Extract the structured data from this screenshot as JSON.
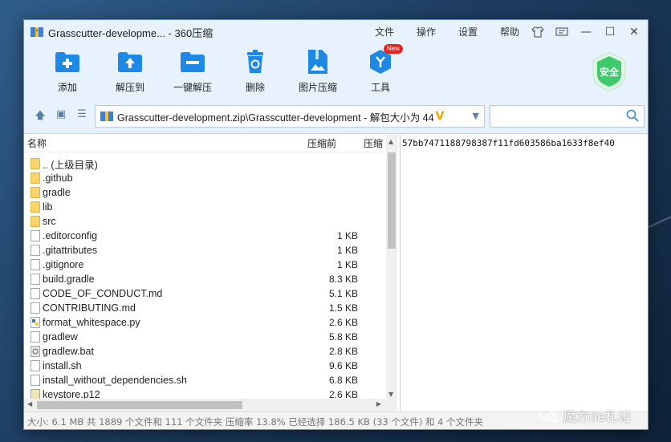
{
  "window": {
    "title": "Grasscutter-developme... - 360压缩",
    "menus": [
      "文件",
      "操作",
      "设置",
      "帮助"
    ]
  },
  "toolbar": {
    "items": [
      {
        "label": "添加",
        "icon": "add-icon"
      },
      {
        "label": "解压到",
        "icon": "extract-to-icon"
      },
      {
        "label": "一键解压",
        "icon": "one-click-extract-icon"
      },
      {
        "label": "删除",
        "icon": "delete-icon"
      },
      {
        "label": "图片压缩",
        "icon": "image-compress-icon"
      },
      {
        "label": "工具",
        "icon": "tools-icon",
        "badge": "New"
      }
    ],
    "safe_badge": "安全"
  },
  "address": {
    "path": "Grasscutter-development.zip\\Grasscutter-development - 解包大小为 44",
    "v_mark": "V",
    "search_placeholder": ""
  },
  "filelist": {
    "columns": {
      "name": "名称",
      "size": "压缩前",
      "packed": "压缩"
    },
    "rows": [
      {
        "name": ".. (上级目录)",
        "size": "",
        "type": "folder"
      },
      {
        "name": ".github",
        "size": "",
        "type": "folder"
      },
      {
        "name": "gradle",
        "size": "",
        "type": "folder"
      },
      {
        "name": "lib",
        "size": "",
        "type": "folder"
      },
      {
        "name": "src",
        "size": "",
        "type": "folder"
      },
      {
        "name": ".editorconfig",
        "size": "1 KB",
        "type": "file"
      },
      {
        "name": ".gitattributes",
        "size": "1 KB",
        "type": "file"
      },
      {
        "name": ".gitignore",
        "size": "1 KB",
        "type": "file"
      },
      {
        "name": "build.gradle",
        "size": "8.3 KB",
        "type": "file"
      },
      {
        "name": "CODE_OF_CONDUCT.md",
        "size": "5.1 KB",
        "type": "file"
      },
      {
        "name": "CONTRIBUTING.md",
        "size": "1.5 KB",
        "type": "file"
      },
      {
        "name": "format_whitespace.py",
        "size": "2.6 KB",
        "type": "python"
      },
      {
        "name": "gradlew",
        "size": "5.8 KB",
        "type": "file"
      },
      {
        "name": "gradlew.bat",
        "size": "2.8 KB",
        "type": "bat"
      },
      {
        "name": "install.sh",
        "size": "9.6 KB",
        "type": "file"
      },
      {
        "name": "install_without_dependencies.sh",
        "size": "6.8 KB",
        "type": "file"
      },
      {
        "name": "keystore.p12",
        "size": "2.6 KB",
        "type": "key"
      }
    ]
  },
  "preview": {
    "text": "57bb7471188798387f11fd603586ba1633f8ef40"
  },
  "status": {
    "text": "大小: 6.1 MB 共 1889 个文件和 111 个文件夹 压缩率 13.8% 已经选择 186.5 KB (33 个文件) 和 4 个文件夹"
  },
  "watermark": {
    "text": "魔方de札记"
  },
  "colors": {
    "chrome_bg": "#e8f2fc",
    "accent_blue": "#1e88e5",
    "folder": "#f9d36b",
    "safe_green": "#3ec96b",
    "new_badge": "#e8231c"
  }
}
